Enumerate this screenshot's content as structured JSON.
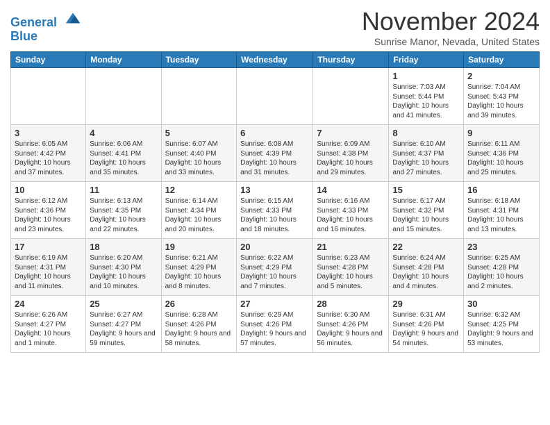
{
  "header": {
    "logo_line1": "General",
    "logo_line2": "Blue",
    "month": "November 2024",
    "location": "Sunrise Manor, Nevada, United States"
  },
  "days_of_week": [
    "Sunday",
    "Monday",
    "Tuesday",
    "Wednesday",
    "Thursday",
    "Friday",
    "Saturday"
  ],
  "weeks": [
    [
      {
        "day": "",
        "info": ""
      },
      {
        "day": "",
        "info": ""
      },
      {
        "day": "",
        "info": ""
      },
      {
        "day": "",
        "info": ""
      },
      {
        "day": "",
        "info": ""
      },
      {
        "day": "1",
        "info": "Sunrise: 7:03 AM\nSunset: 5:44 PM\nDaylight: 10 hours and 41 minutes."
      },
      {
        "day": "2",
        "info": "Sunrise: 7:04 AM\nSunset: 5:43 PM\nDaylight: 10 hours and 39 minutes."
      }
    ],
    [
      {
        "day": "3",
        "info": "Sunrise: 6:05 AM\nSunset: 4:42 PM\nDaylight: 10 hours and 37 minutes."
      },
      {
        "day": "4",
        "info": "Sunrise: 6:06 AM\nSunset: 4:41 PM\nDaylight: 10 hours and 35 minutes."
      },
      {
        "day": "5",
        "info": "Sunrise: 6:07 AM\nSunset: 4:40 PM\nDaylight: 10 hours and 33 minutes."
      },
      {
        "day": "6",
        "info": "Sunrise: 6:08 AM\nSunset: 4:39 PM\nDaylight: 10 hours and 31 minutes."
      },
      {
        "day": "7",
        "info": "Sunrise: 6:09 AM\nSunset: 4:38 PM\nDaylight: 10 hours and 29 minutes."
      },
      {
        "day": "8",
        "info": "Sunrise: 6:10 AM\nSunset: 4:37 PM\nDaylight: 10 hours and 27 minutes."
      },
      {
        "day": "9",
        "info": "Sunrise: 6:11 AM\nSunset: 4:36 PM\nDaylight: 10 hours and 25 minutes."
      }
    ],
    [
      {
        "day": "10",
        "info": "Sunrise: 6:12 AM\nSunset: 4:36 PM\nDaylight: 10 hours and 23 minutes."
      },
      {
        "day": "11",
        "info": "Sunrise: 6:13 AM\nSunset: 4:35 PM\nDaylight: 10 hours and 22 minutes."
      },
      {
        "day": "12",
        "info": "Sunrise: 6:14 AM\nSunset: 4:34 PM\nDaylight: 10 hours and 20 minutes."
      },
      {
        "day": "13",
        "info": "Sunrise: 6:15 AM\nSunset: 4:33 PM\nDaylight: 10 hours and 18 minutes."
      },
      {
        "day": "14",
        "info": "Sunrise: 6:16 AM\nSunset: 4:33 PM\nDaylight: 10 hours and 16 minutes."
      },
      {
        "day": "15",
        "info": "Sunrise: 6:17 AM\nSunset: 4:32 PM\nDaylight: 10 hours and 15 minutes."
      },
      {
        "day": "16",
        "info": "Sunrise: 6:18 AM\nSunset: 4:31 PM\nDaylight: 10 hours and 13 minutes."
      }
    ],
    [
      {
        "day": "17",
        "info": "Sunrise: 6:19 AM\nSunset: 4:31 PM\nDaylight: 10 hours and 11 minutes."
      },
      {
        "day": "18",
        "info": "Sunrise: 6:20 AM\nSunset: 4:30 PM\nDaylight: 10 hours and 10 minutes."
      },
      {
        "day": "19",
        "info": "Sunrise: 6:21 AM\nSunset: 4:29 PM\nDaylight: 10 hours and 8 minutes."
      },
      {
        "day": "20",
        "info": "Sunrise: 6:22 AM\nSunset: 4:29 PM\nDaylight: 10 hours and 7 minutes."
      },
      {
        "day": "21",
        "info": "Sunrise: 6:23 AM\nSunset: 4:28 PM\nDaylight: 10 hours and 5 minutes."
      },
      {
        "day": "22",
        "info": "Sunrise: 6:24 AM\nSunset: 4:28 PM\nDaylight: 10 hours and 4 minutes."
      },
      {
        "day": "23",
        "info": "Sunrise: 6:25 AM\nSunset: 4:28 PM\nDaylight: 10 hours and 2 minutes."
      }
    ],
    [
      {
        "day": "24",
        "info": "Sunrise: 6:26 AM\nSunset: 4:27 PM\nDaylight: 10 hours and 1 minute."
      },
      {
        "day": "25",
        "info": "Sunrise: 6:27 AM\nSunset: 4:27 PM\nDaylight: 9 hours and 59 minutes."
      },
      {
        "day": "26",
        "info": "Sunrise: 6:28 AM\nSunset: 4:26 PM\nDaylight: 9 hours and 58 minutes."
      },
      {
        "day": "27",
        "info": "Sunrise: 6:29 AM\nSunset: 4:26 PM\nDaylight: 9 hours and 57 minutes."
      },
      {
        "day": "28",
        "info": "Sunrise: 6:30 AM\nSunset: 4:26 PM\nDaylight: 9 hours and 56 minutes."
      },
      {
        "day": "29",
        "info": "Sunrise: 6:31 AM\nSunset: 4:26 PM\nDaylight: 9 hours and 54 minutes."
      },
      {
        "day": "30",
        "info": "Sunrise: 6:32 AM\nSunset: 4:25 PM\nDaylight: 9 hours and 53 minutes."
      }
    ]
  ]
}
